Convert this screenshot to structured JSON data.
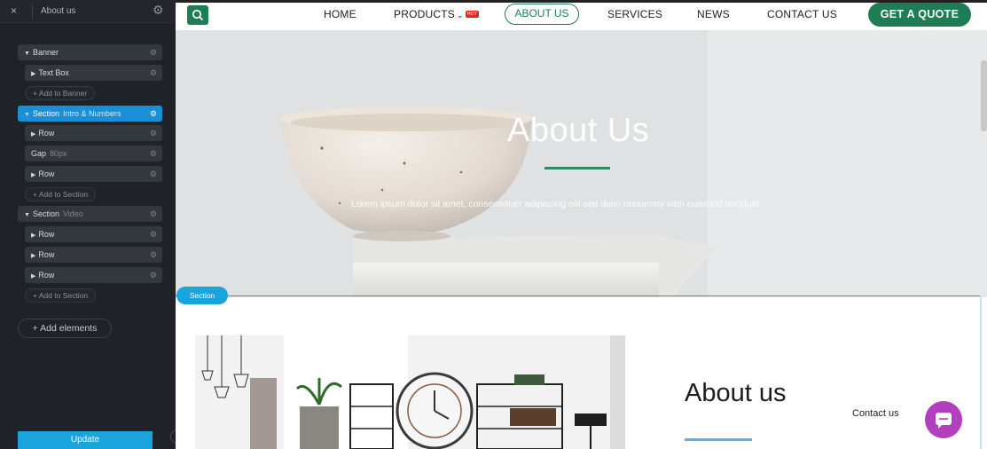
{
  "sidebar": {
    "title": "About us",
    "close_glyph": "×",
    "settings_icon": "gear-icon",
    "tree": [
      {
        "label": "Banner",
        "sub": ""
      },
      {
        "label": "Text Box",
        "sub": ""
      },
      {
        "label": "Section",
        "sub": "Intro & Numbers"
      },
      {
        "label": "Row",
        "sub": ""
      },
      {
        "label": "Gap",
        "sub": "80px"
      },
      {
        "label": "Row",
        "sub": ""
      },
      {
        "label": "Section",
        "sub": "Video"
      },
      {
        "label": "Row",
        "sub": ""
      },
      {
        "label": "Row",
        "sub": ""
      },
      {
        "label": "Row",
        "sub": ""
      }
    ],
    "adders": [
      "+ Add to Banner",
      "+ Add to Section",
      "+ Add to Section"
    ],
    "add_elements": "+ Add elements",
    "update": "Update"
  },
  "navbar": {
    "items": [
      "HOME",
      "PRODUCTS",
      "ABOUT US",
      "SERVICES",
      "NEWS",
      "CONTACT US"
    ],
    "hot_badge": "HOT",
    "products_caret": "⌄",
    "cta": "GET A QUOTE",
    "active_item": "ABOUT US"
  },
  "banner": {
    "title": "About Us",
    "text": "Lorem ipsum dolor sit amet, consectetuer adipiscing elit sed diam nonummy nibh euismod tincidunt"
  },
  "section_label": "Section",
  "about": {
    "heading": "About us",
    "contact": "Contact us"
  },
  "colors": {
    "brand_green": "#1e7d55",
    "builder_blue": "#1aa3dc",
    "sidebar_bg": "#1f2227",
    "chat_purple": "#b23fbd"
  }
}
